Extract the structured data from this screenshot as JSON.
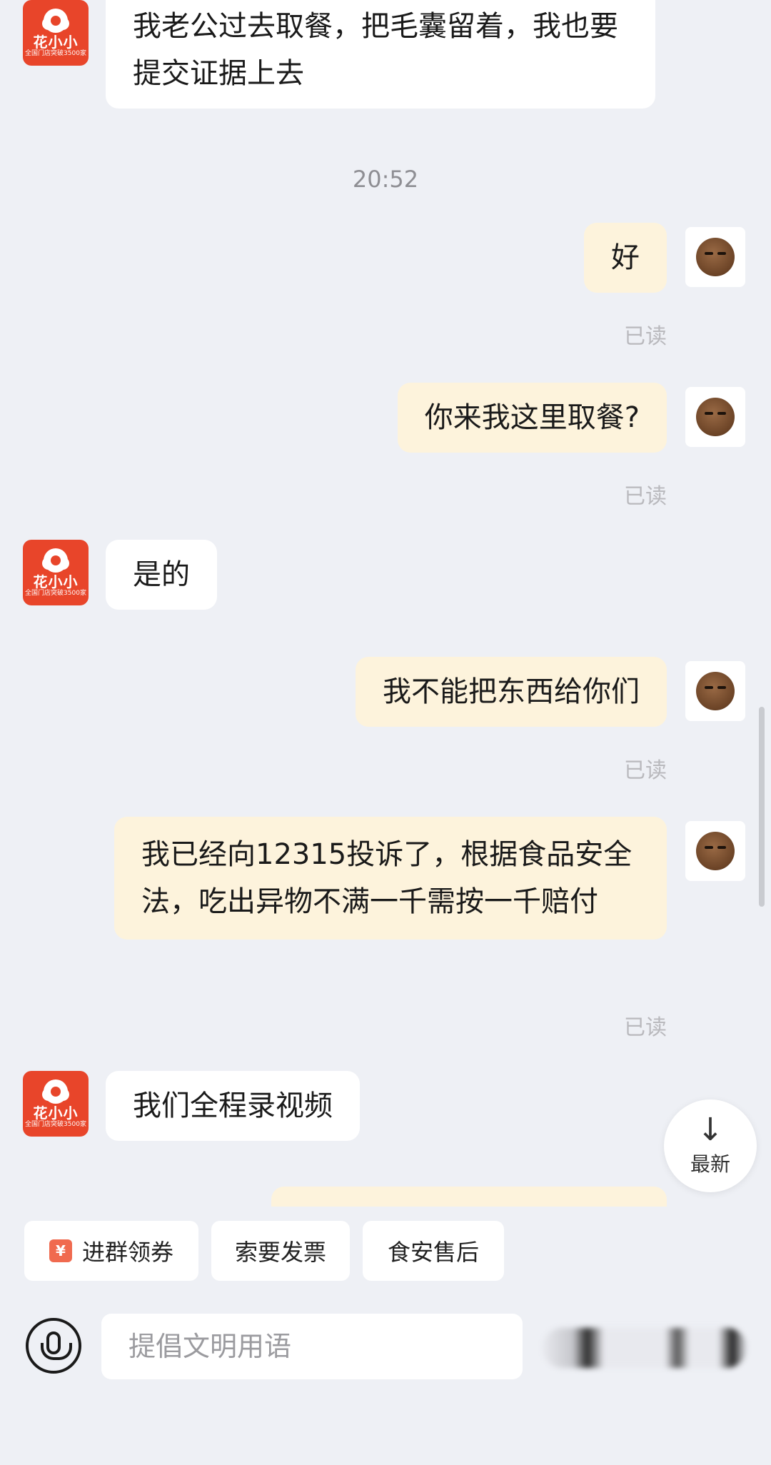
{
  "time_divider": "20:52",
  "merchant": {
    "brand": "花小小",
    "sub": "全国门店突破3500家"
  },
  "messages": [
    {
      "side": "left",
      "text": "我老公过去取餐，把毛囊留着，我也要提交证据上去"
    },
    {
      "side": "right",
      "text": "好",
      "read": "已读"
    },
    {
      "side": "right",
      "text": "你来我这里取餐?",
      "read": "已读"
    },
    {
      "side": "left",
      "text": "是的"
    },
    {
      "side": "right",
      "text": "我不能把东西给你们",
      "read": "已读"
    },
    {
      "side": "right",
      "text": "我已经向12315投诉了，根据食品安全法，吃出异物不满一千需按一千赔付",
      "read": "已读"
    },
    {
      "side": "left",
      "text": "我们全程录视频"
    }
  ],
  "latest_button": {
    "arrow": "↓",
    "label": "最新"
  },
  "quick_actions": [
    {
      "label": "进群领券",
      "icon": "yen-icon",
      "icon_glyph": "¥"
    },
    {
      "label": "索要发票"
    },
    {
      "label": "食安售后"
    }
  ],
  "input": {
    "placeholder": "提倡文明用语"
  },
  "colors": {
    "background": "#eef0f5",
    "bubble_left": "#ffffff",
    "bubble_right": "#fdf3dc",
    "brand_red": "#e8452a",
    "read_receipt": "#b9b9bd"
  }
}
